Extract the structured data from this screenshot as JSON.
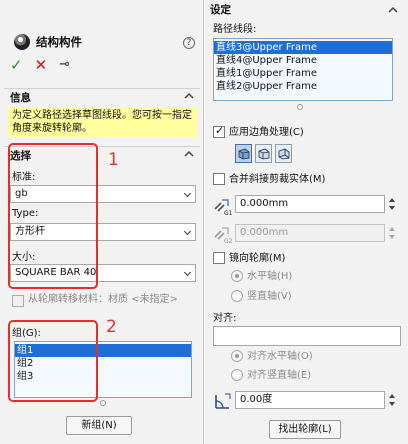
{
  "left": {
    "title": "结构构件",
    "toolbar": {
      "ok": "✓",
      "cancel": "✕",
      "pin": "⊸"
    },
    "help": "?",
    "info": {
      "header": "信息",
      "text": "为定义路径选择草图线段。您可按一指定角度来旋转轮廓。"
    },
    "selection": {
      "header": "选择",
      "standard_label": "标准:",
      "standard_value": "gb",
      "type_label": "Type:",
      "type_value": "方形杆",
      "size_label": "大小:",
      "size_value": "SQUARE BAR 40",
      "transfer_material_label": "从轮廓转移材料：材质 <未指定>"
    },
    "group": {
      "label": "组(G):",
      "items": [
        "组1",
        "组2",
        "组3"
      ]
    },
    "new_group_button": "新组(N)",
    "annotations": {
      "box1": "1",
      "box2": "2"
    },
    "colors": {
      "annotation": "#e3302f",
      "selection": "#1f6dd6",
      "info": "#ffff9e"
    }
  },
  "right": {
    "settings_header": "设定",
    "path_label": "路径线段:",
    "path_items": [
      "直线3@Upper Frame",
      "直线4@Upper Frame",
      "直线1@Upper Frame",
      "直线2@Upper Frame"
    ],
    "corner_treatment_label": "应用边角处理(C)",
    "merge_label": "合并斜接剪裁实体(M)",
    "gap1_value": "0.000mm",
    "gap1_icon_label": "G1",
    "gap2_value": "0.000mm",
    "gap2_icon_label": "G2",
    "mirror_label": "镜向轮廓(M)",
    "horizontal_axis_label": "水平轴(H)",
    "vertical_axis_label": "竖直轴(V)",
    "align_label": "对齐:",
    "align_horizontal_label": "对齐水平轴(O)",
    "align_vertical_label": "对齐竖直轴(E)",
    "rotation_value": "0.00度",
    "find_profile_button": "找出轮廓(L)"
  }
}
